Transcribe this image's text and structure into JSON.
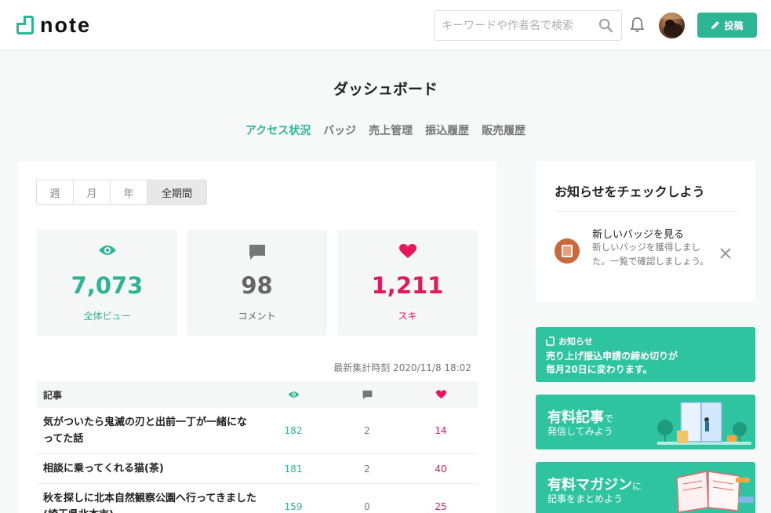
{
  "header": {
    "logo_text": "note",
    "search_placeholder": "キーワードや作者名で検索",
    "post_label": "投稿"
  },
  "page": {
    "title": "ダッシュボード",
    "tabs": [
      {
        "label": "アクセス状況",
        "active": true
      },
      {
        "label": "バッジ",
        "active": false
      },
      {
        "label": "売上管理",
        "active": false
      },
      {
        "label": "振込履歴",
        "active": false
      },
      {
        "label": "販売履歴",
        "active": false
      }
    ]
  },
  "stats": {
    "periods": [
      "週",
      "月",
      "年",
      "全期間"
    ],
    "selected_period": "全期間",
    "views": {
      "value": "7,073",
      "label": "全体ビュー"
    },
    "comments": {
      "value": "98",
      "label": "コメント"
    },
    "likes": {
      "value": "1,211",
      "label": "スキ"
    },
    "updated": "最新集計時刻 2020/11/8 18:02"
  },
  "table": {
    "header": "記事",
    "rows": [
      {
        "title": "気がついたら鬼滅の刃と出前一丁が一緒になってた話",
        "views": "182",
        "comments": "2",
        "likes": "14"
      },
      {
        "title": "相談に乗ってくれる猫(茶)",
        "views": "181",
        "comments": "2",
        "likes": "40"
      },
      {
        "title": "秋を探しに北本自然観察公園へ行ってきました(埼玉県北本市)",
        "views": "159",
        "comments": "0",
        "likes": "25"
      }
    ]
  },
  "sidebar": {
    "notice_title": "お知らせをチェックしよう",
    "notice_heading": "新しいバッジを見る",
    "notice_body": "新しいバッジを獲得しました。一覧で確認しましょう。",
    "banner1_tag": "お知らせ",
    "banner1_text1": "売り上げ振込申請の締め切りが",
    "banner1_text2": "毎月20日に変わります。",
    "banner2_big": "有料記事",
    "banner2_small": "で",
    "banner2_sub": "発信してみよう",
    "banner3_big": "有料マガジン",
    "banner3_small": "に",
    "banner3_sub": "記事をまとめよう"
  },
  "colors": {
    "accent": "#2cb696",
    "like": "#e8175d",
    "banner": "#2ec4a0"
  }
}
